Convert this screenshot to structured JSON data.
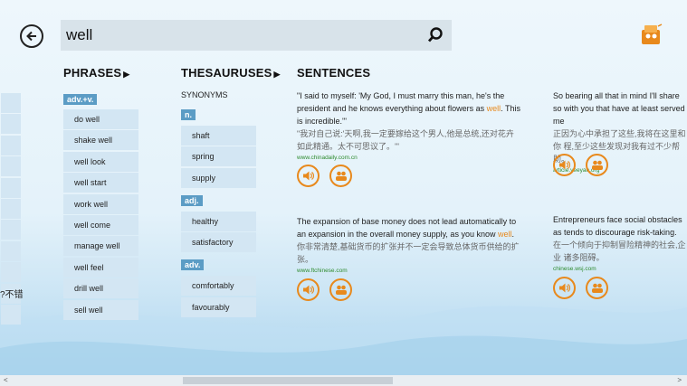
{
  "search": {
    "value": "well"
  },
  "columns": {
    "phrases": "PHRASES",
    "thesauruses": "THESAURUSES",
    "sentences": "SENTENCES"
  },
  "left_partial_text": "?不错",
  "phrases": {
    "tag": "adv.+v.",
    "items": [
      "do well",
      "shake well",
      "well look",
      "well start",
      "work well",
      "well come",
      "manage well",
      "well feel",
      "drill well",
      "sell well"
    ]
  },
  "thesaurus": {
    "synonyms_label": "SYNONYMS",
    "groups": [
      {
        "tag": "n.",
        "items": [
          "shaft",
          "spring",
          "supply"
        ]
      },
      {
        "tag": "adj.",
        "items": [
          "healthy",
          "satisfactory"
        ]
      },
      {
        "tag": "adv.",
        "items": [
          "comfortably",
          "favourably"
        ]
      }
    ]
  },
  "sentences": [
    {
      "en_before": "\"I said to myself: 'My God, I must marry this man, he's the president and he knows everything about flowers as ",
      "en_hl": "well",
      "en_after": ". This is incredible.'\"",
      "cn": "\"我对自己说:'天啊,我一定要嫁给这个男人,他是总统,还对花卉如此精通。太不可思议了。'\"",
      "source": "www.chinadaily.com.cn"
    },
    {
      "en_before": "The expansion of base money does not lead automatically to an expansion in the overall money supply, as you know ",
      "en_hl": "well",
      "en_after": ".",
      "cn": "你非常清楚,基础货币的扩张并不一定会导致总体货币供给的扩张。",
      "source": "www.ftchinese.com"
    },
    {
      "en_before": "So bearing all that in mind I'll share so with you that have at least served me",
      "en_hl": "",
      "en_after": "",
      "cn": "正因为心中承担了这些,我将在这里和你 程,至少这些发现对我有过不少帮助。",
      "source": "article.yeeyan.org"
    },
    {
      "en_before": "Entrepreneurs face social obstacles as tends to discourage risk-taking.",
      "en_hl": "",
      "en_after": "",
      "cn": "在一个倾向于抑制冒险精神的社会,企业 诸多阻碍。",
      "source": "chinese.wsj.com"
    }
  ],
  "icons": {
    "back": "back-arrow-icon",
    "search": "search-icon",
    "logo": "dictionary-logo-icon",
    "speaker": "speaker-icon",
    "share": "people-icon"
  },
  "colors": {
    "accent": "#e8891c",
    "tag": "#5b9cc5",
    "source": "#2e8b2e"
  }
}
